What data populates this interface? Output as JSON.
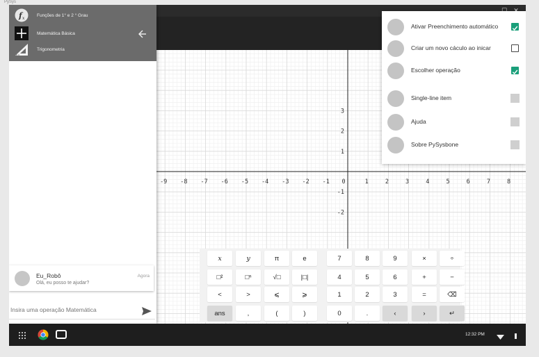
{
  "topbar": {
    "crumb": "PySys"
  },
  "window": {
    "controls": {
      "minimize": "_",
      "maximize": "☐",
      "close": "✕"
    }
  },
  "drawer": {
    "items": [
      {
        "label": "Funções de 1° e 2 ° Grau",
        "icon": "function-fx-icon"
      },
      {
        "label": "Matemática Básica",
        "icon": "plus-icon"
      },
      {
        "label": "Trigonometria",
        "icon": "triangle-ruler-icon"
      }
    ],
    "back_icon": "arrow-left-icon"
  },
  "chat": {
    "name": "Eu_Robô",
    "message": "Olá, eu posso te ajudar?",
    "time": "Agora"
  },
  "input": {
    "placeholder": "Insira uma operação Matemática"
  },
  "menu": {
    "items": [
      {
        "label": "Ativar Preenchimento automático",
        "state": "checked"
      },
      {
        "label": "Criar um novo cáculo ao inicar",
        "state": "unchecked"
      },
      {
        "label": "Escolher operação",
        "state": "checked"
      },
      {
        "label": "Single-line item",
        "state": "disabled"
      },
      {
        "label": "Ajuda",
        "state": "disabled"
      },
      {
        "label": "Sobre PySysbone",
        "state": "disabled"
      }
    ]
  },
  "graph": {
    "x_ticks": [
      "-9",
      "-8",
      "-7",
      "-6",
      "-5",
      "-4",
      "-3",
      "-2",
      "-1",
      "0",
      "1",
      "2",
      "3",
      "4",
      "5",
      "6",
      "7",
      "8"
    ],
    "y_ticks": [
      "3",
      "2",
      "1",
      "-1",
      "-2"
    ]
  },
  "keypad": {
    "rows": [
      [
        "x",
        "y",
        "π",
        "e",
        "7",
        "8",
        "9",
        "×",
        "÷"
      ],
      [
        "□²",
        "□ⁿ",
        "√□",
        "|□|",
        "4",
        "5",
        "6",
        "+",
        "−"
      ],
      [
        "<",
        ">",
        "⩽",
        "⩾",
        "1",
        "2",
        "3",
        "=",
        "⌫"
      ],
      [
        "ans",
        ",",
        "(",
        ")",
        "0",
        ".",
        "‹",
        "›",
        "↵"
      ]
    ]
  },
  "shelf": {
    "time": "12:32 PM",
    "apps": [
      "launcher-icon",
      "chrome-icon",
      "window-icon"
    ]
  },
  "colors": {
    "accent": "#1a9f7a",
    "appbar": "#232323",
    "drawer_header": "#6b6b6b"
  }
}
